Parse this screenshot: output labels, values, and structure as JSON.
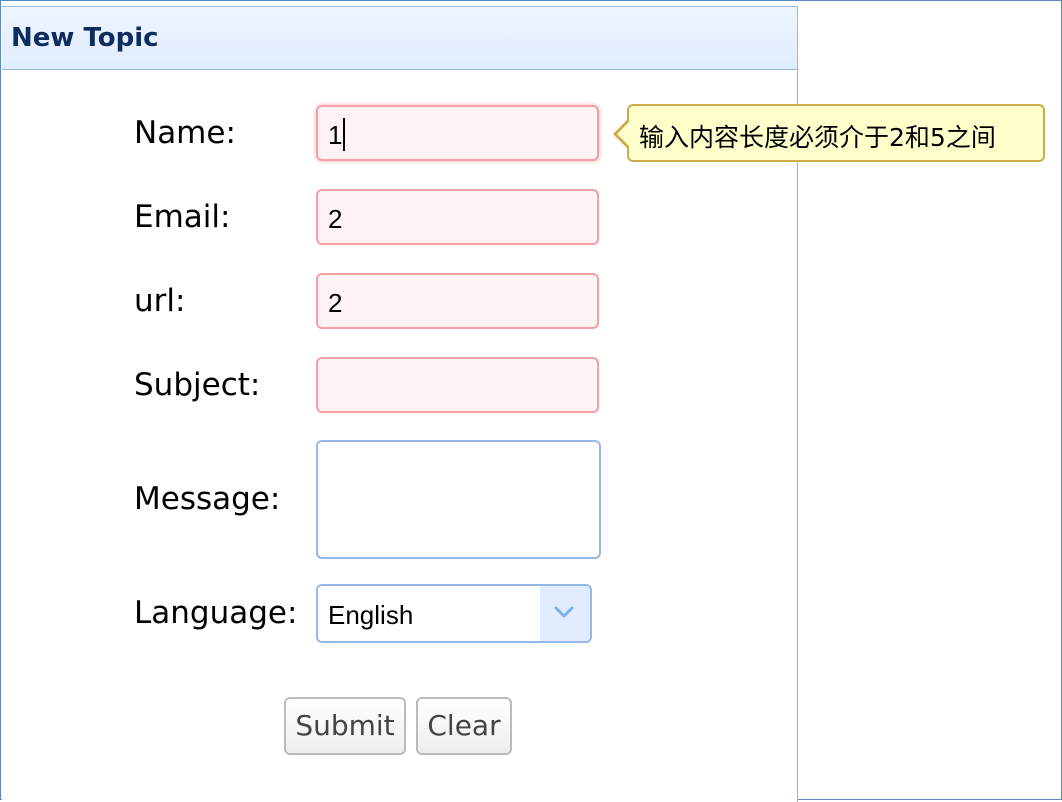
{
  "panel": {
    "title": "New Topic"
  },
  "form": {
    "name": {
      "label": "Name:",
      "value": "1"
    },
    "email": {
      "label": "Email:",
      "value": "2"
    },
    "url": {
      "label": "url:",
      "value": "2"
    },
    "subject": {
      "label": "Subject:",
      "value": ""
    },
    "message": {
      "label": "Message:",
      "value": ""
    },
    "language": {
      "label": "Language:",
      "value": "English"
    }
  },
  "tooltip": {
    "text": "输入内容长度必须介于2和5之间"
  },
  "buttons": {
    "submit_label": "Submit",
    "clear_label": "Clear"
  },
  "colors": {
    "invalid_border": "#f2a0a6",
    "invalid_background": "#fff3f3",
    "panel_border": "#95b8e7",
    "header_text": "#0e2d5f",
    "tooltip_background": "#ffffcc"
  },
  "icons": {
    "combo_arrow": "chevron-down-icon"
  }
}
